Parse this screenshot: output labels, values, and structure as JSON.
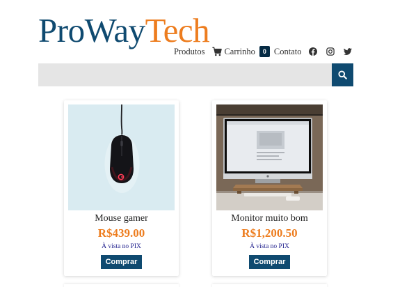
{
  "logo": {
    "part1": "ProWay",
    "part2": "Tech"
  },
  "nav": {
    "produtos": "Produtos",
    "carrinho": "Carrinho",
    "cart_count": "0",
    "contato": "Contato",
    "social_icons": [
      "facebook-icon",
      "instagram-icon",
      "twitter-icon"
    ]
  },
  "search": {
    "value": "",
    "placeholder": ""
  },
  "products": [
    {
      "name": "Mouse gamer",
      "price": "R$439.00",
      "payment": "À vista no PIX",
      "buy_label": "Comprar"
    },
    {
      "name": "Monitor muito bom",
      "price": "R$1,200.50",
      "payment": "À vista no PIX",
      "buy_label": "Comprar"
    }
  ],
  "colors": {
    "brand_blue": "#0f4a70",
    "brand_orange": "#ed7d1f",
    "badge_bg": "#062b44",
    "search_bg": "#e5e5e5"
  }
}
